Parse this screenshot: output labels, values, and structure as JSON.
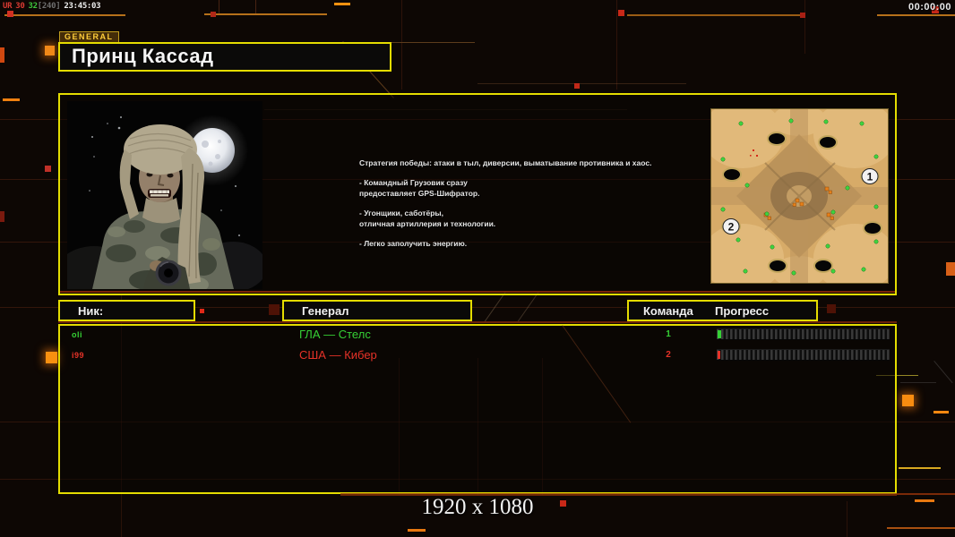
{
  "overlay": {
    "perf": {
      "app": "UR",
      "fps": "30",
      "fps2": "32",
      "cap": "[240]",
      "clock": "23:45:03"
    },
    "timer": "00:00:00"
  },
  "header": {
    "tag": "GENERAL",
    "title": "Принц Кассад"
  },
  "briefing": {
    "paragraphs": [
      "Стратегия победы: атаки в тыл, диверсии, выматывание противника и хаос.",
      "- Командный Грузовик сразу\nпредоставляет GPS-Шифратор.",
      "- Угонщики, саботёры,\nотличная артиллерия и технологии.",
      "- Легко заполучить энергию."
    ]
  },
  "lobby": {
    "columns": {
      "nick": "Ник:",
      "general": "Генерал",
      "team": "Команда",
      "progress": "Прогресс"
    },
    "players": [
      {
        "nick": "oli",
        "general": "ГЛА — Стелс",
        "team": "1",
        "progress_percent": 2,
        "color": "#35d035"
      },
      {
        "nick": "i99",
        "general": "США — Кибер",
        "team": "2",
        "progress_percent": 1,
        "color": "#e63228"
      }
    ]
  },
  "map": {
    "start_positions": [
      "1",
      "2"
    ]
  },
  "footer": {
    "resolution": "1920 x 1080"
  },
  "colors": {
    "accent_yellow": "#e4dc00",
    "accent_orange": "#ff8c10",
    "green": "#35d035",
    "red": "#e63228"
  }
}
